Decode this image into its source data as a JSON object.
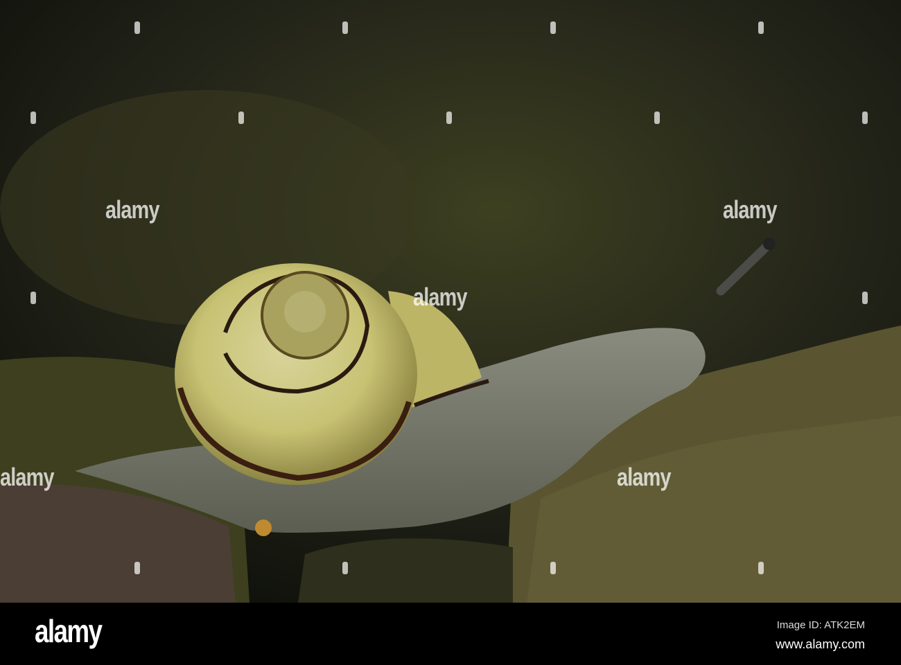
{
  "watermark": "alamy",
  "footer": {
    "logo": "alamy",
    "image_id": "Image ID: ATK2EM",
    "url": "www.alamy.com"
  }
}
